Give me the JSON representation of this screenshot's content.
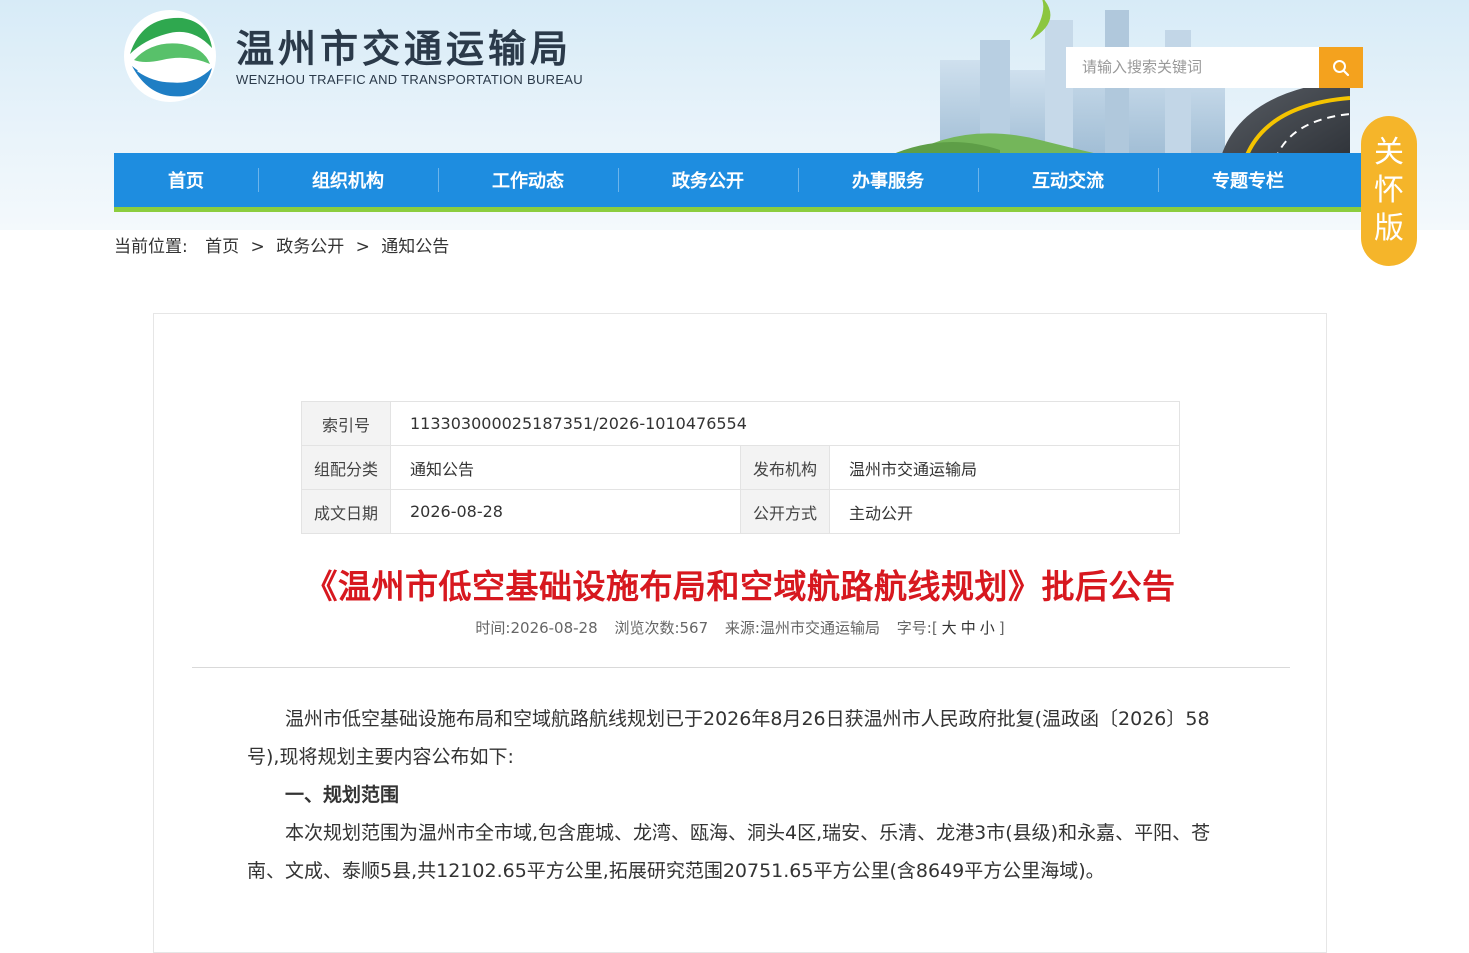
{
  "header": {
    "site_title": "温州市交通运输局",
    "site_subtitle": "WENZHOU TRAFFIC AND TRANSPORTATION BUREAU",
    "search_placeholder": "请输入搜索关键词"
  },
  "nav": {
    "items": [
      "首页",
      "组织机构",
      "工作动态",
      "政务公开",
      "办事服务",
      "互动交流",
      "专题专栏"
    ]
  },
  "care_badge": [
    "关",
    "怀",
    "版"
  ],
  "breadcrumb": {
    "prefix": "当前位置:",
    "items": [
      "首页",
      "政务公开",
      "通知公告"
    ],
    "separator": ">"
  },
  "meta": {
    "index_label": "索引号",
    "index_value": "113303000025187351/2026-1010476554",
    "category_label": "组配分类",
    "category_value": "通知公告",
    "publisher_label": "发布机构",
    "publisher_value": "温州市交通运输局",
    "date_label": "成文日期",
    "date_value": "2026-08-28",
    "disclosure_label": "公开方式",
    "disclosure_value": "主动公开"
  },
  "article": {
    "title": "《温州市低空基础设施布局和空域航路航线规划》批后公告",
    "info": {
      "time": "时间:2026-08-28",
      "views": "浏览次数:567",
      "source": "来源:温州市交通运输局",
      "font_label": "字号:",
      "font_open": "[",
      "font_large": "大",
      "font_medium": "中",
      "font_small": "小",
      "font_close": "]"
    },
    "para1": "温州市低空基础设施布局和空域航路航线规划已于2026年8月26日获温州市人民政府批复(温政函〔2026〕58号),现将规划主要内容公布如下:",
    "section1_heading": "一、规划范围",
    "para2": "本次规划范围为温州市全市域,包含鹿城、龙湾、瓯海、洞头4区,瑞安、乐清、龙港3市(县级)和永嘉、平阳、苍南、文成、泰顺5县,共12102.65平方公里,拓展研究范围20751.65平方公里(含8649平方公里海域)。"
  },
  "colors": {
    "nav_blue": "#1e8de0",
    "nav_green": "#8ccd3e",
    "title_red": "#d7181f",
    "accent_orange": "#f4a21e",
    "badge_yellow": "#f5b52a"
  }
}
